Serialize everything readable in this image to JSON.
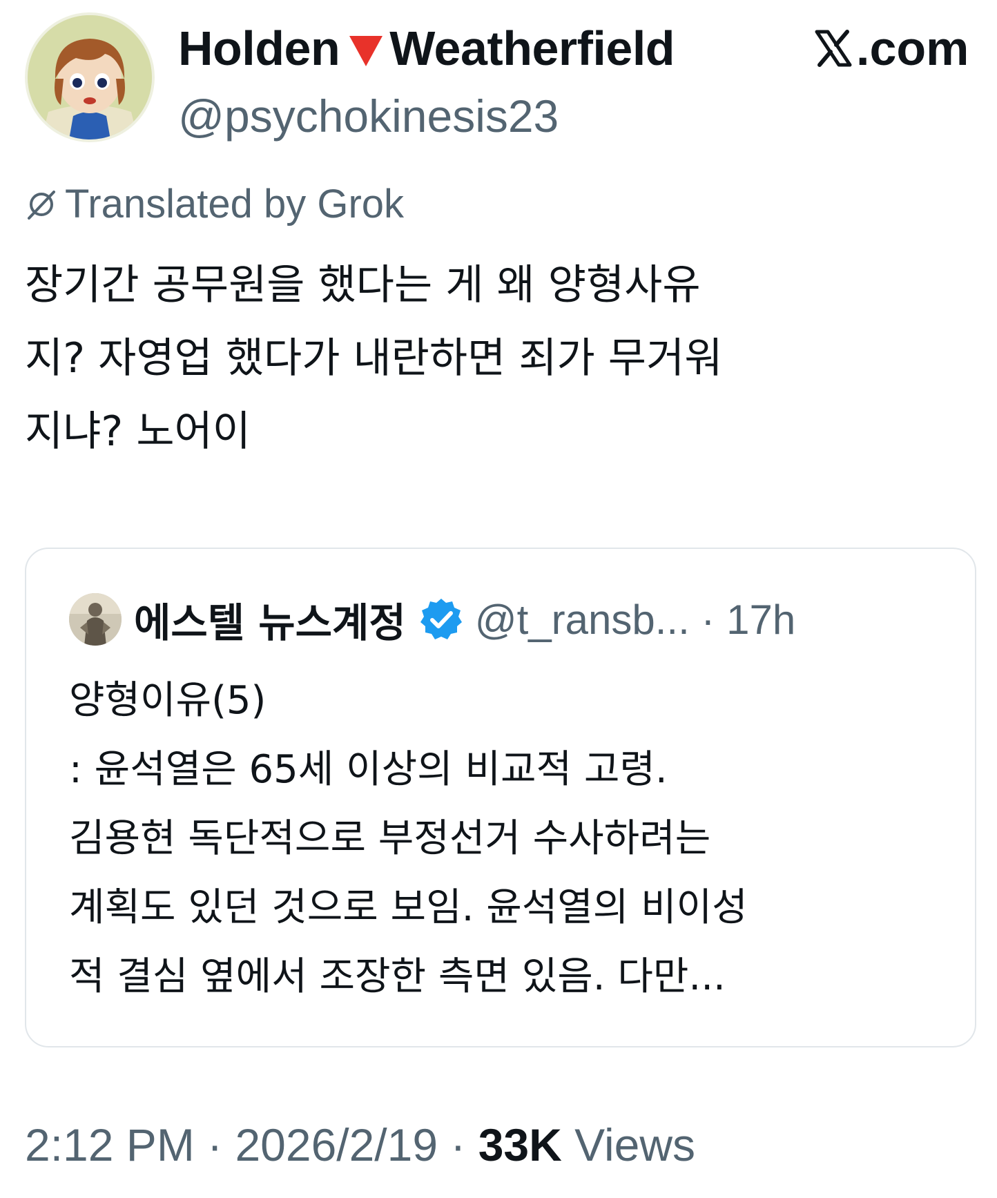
{
  "author": {
    "name_first": "Holden",
    "name_last": "Weatherfield",
    "emoji_icon": "red-down-triangle-icon",
    "handle": "@psychokinesis23",
    "avatar_icon": "cartoon-girl-avatar"
  },
  "source": {
    "site": ".com",
    "logo_icon": "x-logo-icon"
  },
  "translation": {
    "label": "Translated by Grok"
  },
  "tweet": {
    "text": "장기간 공무원을 했다는 게 왜 양형사유\n지? 자영업 했다가 내란하면 죄가 무거워\n지냐? 노어이"
  },
  "quote": {
    "author_name": "에스텔 뉴스계정",
    "verified_icon": "verified-badge-icon",
    "handle_time": "@t_ransb... · 17h",
    "text": "양형이유(5)\n: 윤석열은 65세 이상의 비교적 고령.\n김용현 독단적으로 부정선거 수사하려는\n계획도 있던 것으로 보임. 윤석열의 비이성\n적 결심 옆에서 조장한 측면 있음. 다만..."
  },
  "meta": {
    "time_date": "2:12 PM · 2026/2/19 · ",
    "views_count": "33K",
    "views_label": " Views"
  },
  "colors": {
    "text": "#0f1419",
    "secondary": "#536471",
    "border": "#e1e6ea",
    "verified": "#1d9bf0",
    "emoji_red": "#e8322a"
  }
}
